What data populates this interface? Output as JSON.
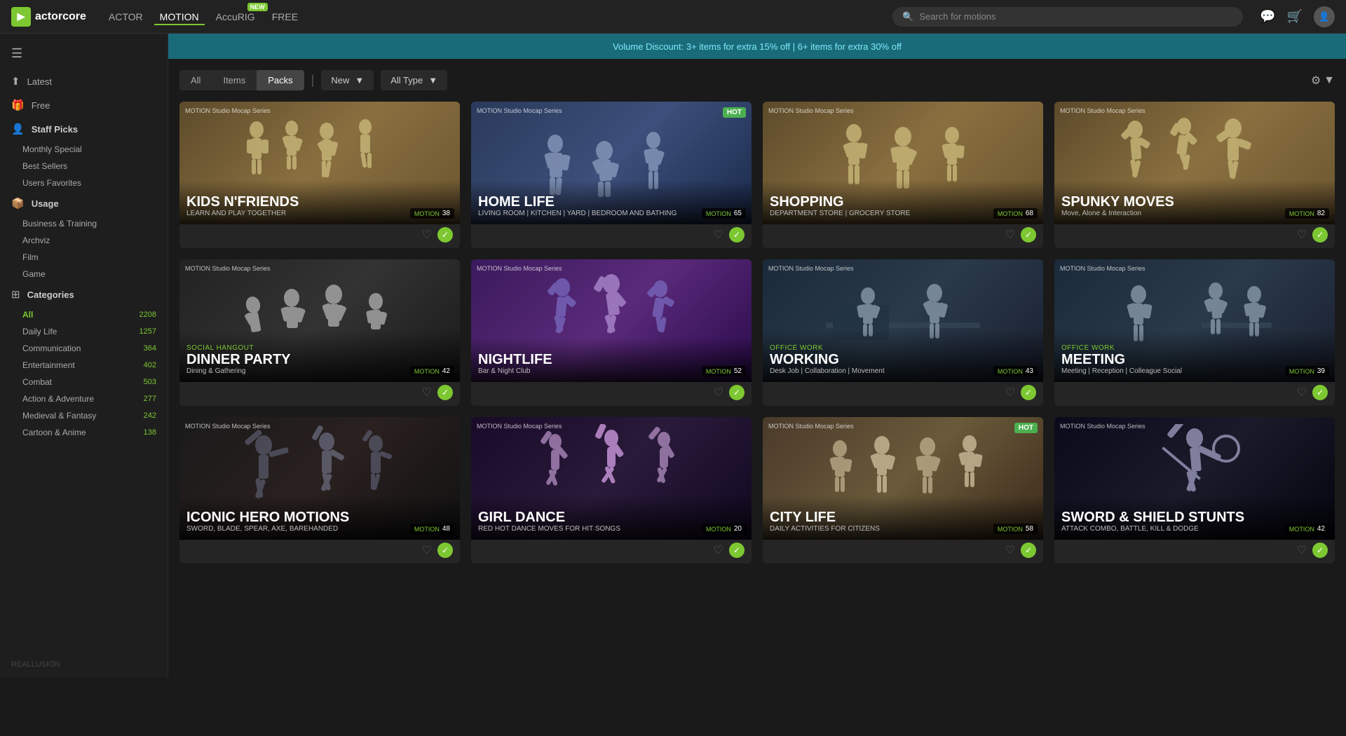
{
  "topnav": {
    "logo_text": "actorcore",
    "links": [
      {
        "label": "ACTOR",
        "active": false
      },
      {
        "label": "MOTION",
        "active": true
      },
      {
        "label": "AccuRIG",
        "active": false,
        "badge": "NEW"
      },
      {
        "label": "FREE",
        "active": false
      }
    ],
    "search_placeholder": "Search for motions"
  },
  "promo": {
    "text": "Volume Discount: 3+ items for extra 15% off | 6+ items for extra 30% off"
  },
  "sidebar": {
    "items": [
      {
        "label": "Latest",
        "icon": "↑"
      },
      {
        "label": "Free",
        "icon": "🎁"
      }
    ],
    "staff_picks": {
      "title": "Staff Picks",
      "items": [
        "Monthly Special",
        "Best Sellers",
        "Users Favorites"
      ]
    },
    "usage": {
      "title": "Usage",
      "items": [
        "Business & Training",
        "Archviz",
        "Film",
        "Game"
      ]
    },
    "categories": {
      "title": "Categories",
      "items": [
        {
          "label": "All",
          "count": "2208",
          "is_all": true
        },
        {
          "label": "Daily Life",
          "count": "1257"
        },
        {
          "label": "Communication",
          "count": "364"
        },
        {
          "label": "Entertainment",
          "count": "402"
        },
        {
          "label": "Combat",
          "count": "503"
        },
        {
          "label": "Action & Adventure",
          "count": "277"
        },
        {
          "label": "Medieval & Fantasy",
          "count": "242"
        },
        {
          "label": "Cartoon & Anime",
          "count": "138"
        }
      ]
    },
    "footer": "REALLUSION"
  },
  "filter_bar": {
    "tabs": [
      {
        "label": "All",
        "active": false
      },
      {
        "label": "Items",
        "active": false
      },
      {
        "label": "Packs",
        "active": true
      }
    ],
    "new_label": "New",
    "all_type_label": "All Type"
  },
  "cards": [
    {
      "id": 1,
      "bg_class": "bg-warm",
      "series": "MOTION Studio Mocap Series",
      "category_tag": "",
      "title": "KIDS N'FRIENDS",
      "subtitle": "LEARN AND PLAY TOGETHER",
      "motion_count": "38",
      "hot": false
    },
    {
      "id": 2,
      "bg_class": "bg-cool",
      "series": "MOTION Studio Mocap Series",
      "category_tag": "",
      "title": "HOME LIFE",
      "subtitle": "LIVING ROOM | KITCHEN | YARD | BEDROOM AND BATHING",
      "motion_count": "65",
      "hot": true
    },
    {
      "id": 3,
      "bg_class": "bg-warm",
      "series": "MOTION Studio Mocap Series",
      "category_tag": "",
      "title": "SHOPPING",
      "subtitle": "DEPARTMENT STORE | GROCERY STORE",
      "motion_count": "68",
      "hot": false
    },
    {
      "id": 4,
      "bg_class": "bg-warm",
      "series": "MOTION Studio Mocap Series",
      "category_tag": "",
      "title": "SPUNKY MOVES",
      "subtitle": "Move, Alone & Interaction",
      "motion_count": "82",
      "hot": false
    },
    {
      "id": 5,
      "bg_class": "bg-dark",
      "series": "MOTION Studio Mocap Series",
      "category_tag": "SOCIAL HANGOUT",
      "title": "DINNER PARTY",
      "subtitle": "Dining & Gathering",
      "motion_count": "42",
      "hot": false
    },
    {
      "id": 6,
      "bg_class": "bg-purple",
      "series": "MOTION Studio Mocap Series",
      "category_tag": "",
      "title": "NIGHTLIFE",
      "subtitle": "Bar & Night Club",
      "motion_count": "52",
      "hot": false
    },
    {
      "id": 7,
      "bg_class": "bg-office",
      "series": "MOTION Studio Mocap Series",
      "category_tag": "OFFICE WORK",
      "title": "WORKING",
      "subtitle": "Desk Job | Collaboration | Movement",
      "motion_count": "43",
      "hot": false
    },
    {
      "id": 8,
      "bg_class": "bg-office",
      "series": "MOTION Studio Mocap Series",
      "category_tag": "OFFICE WORK",
      "title": "MEETING",
      "subtitle": "Meeting | Reception | Colleague Social",
      "motion_count": "39",
      "hot": false
    },
    {
      "id": 9,
      "bg_class": "bg-action",
      "series": "MOTION Studio Mocap Series",
      "category_tag": "",
      "title": "ICONIC HERO MOTIONS",
      "subtitle": "SWORD, BLADE, SPEAR, AXE, BAREHANDED",
      "motion_count": "48",
      "hot": false
    },
    {
      "id": 10,
      "bg_class": "bg-dance",
      "series": "MOTION Studio Mocap Series",
      "category_tag": "",
      "title": "GIRL DANCE",
      "subtitle": "RED HOT DANCE MOVES FOR HIT SONGS",
      "motion_count": "20",
      "hot": false
    },
    {
      "id": 11,
      "bg_class": "bg-street",
      "series": "MOTION Studio Mocap Series",
      "category_tag": "",
      "title": "CITY LIFE",
      "subtitle": "DAILY ACTIVITIES FOR CITIZENS",
      "motion_count": "58",
      "hot": true
    },
    {
      "id": 12,
      "bg_class": "bg-sword",
      "series": "MOTION Studio Mocap Series",
      "category_tag": "",
      "title": "SWORD & SHIELD STUNTS",
      "subtitle": "ATTACK COMBO, BATTLE, KILL & DODGE",
      "motion_count": "42",
      "hot": false
    }
  ]
}
